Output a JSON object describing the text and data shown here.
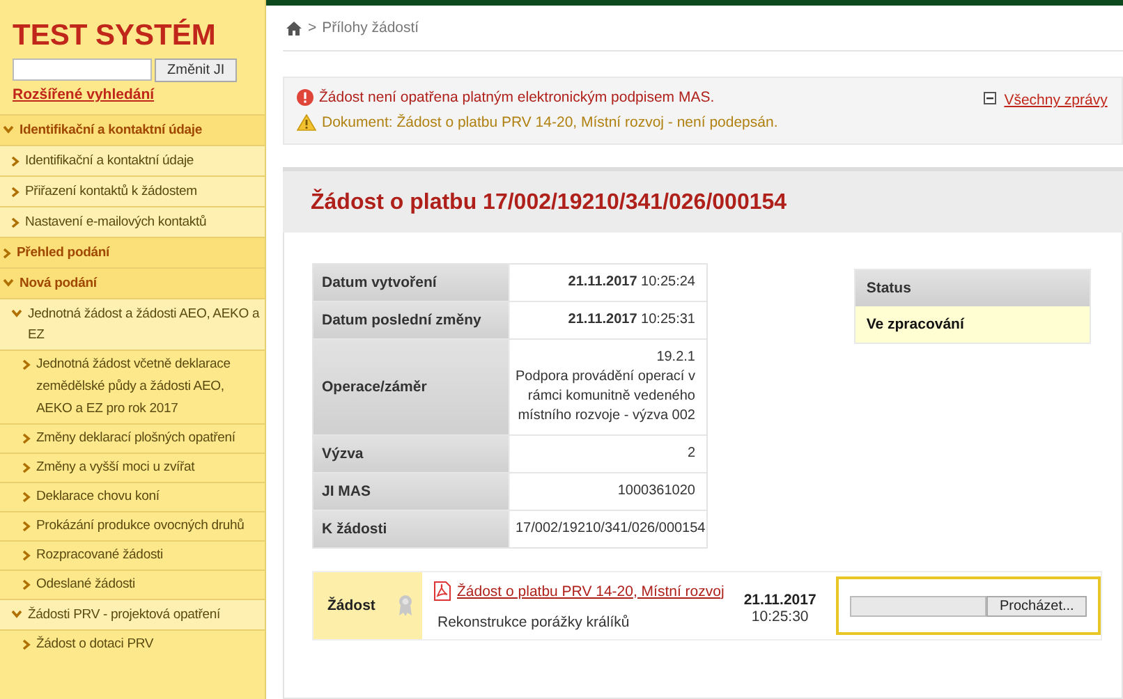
{
  "sidebar": {
    "title": "TEST SYSTÉM",
    "search_button": "Změnit JI",
    "advanced_search_link": "Rozšířené vyhledání",
    "items": [
      {
        "label": "Identifikační a kontaktní údaje",
        "expanded": true,
        "children": [
          {
            "label": "Identifikační a kontaktní údaje"
          },
          {
            "label": "Přiřazení kontaktů k žádostem"
          },
          {
            "label": "Nastavení e-mailových kontaktů"
          }
        ]
      },
      {
        "label": "Přehled podání",
        "expanded": false
      },
      {
        "label": "Nová podání",
        "expanded": true,
        "children": [
          {
            "label": "Jednotná žádost a žádosti AEO, AEKO a EZ",
            "expanded": true,
            "children": [
              {
                "label": "Jednotná žádost včetně deklarace zemědělské půdy a žádosti AEO, AEKO a EZ pro rok 2017"
              },
              {
                "label": "Změny deklarací plošných opatření"
              },
              {
                "label": "Změny a vyšší moci u zvířat"
              },
              {
                "label": "Deklarace chovu koní"
              },
              {
                "label": "Prokázání produkce ovocných druhů"
              },
              {
                "label": "Rozpracované žádosti"
              },
              {
                "label": "Odeslané žádosti"
              }
            ]
          },
          {
            "label": "Žádosti PRV - projektová opatření",
            "expanded": true,
            "children": [
              {
                "label": "Žádost o dotaci PRV"
              }
            ]
          }
        ]
      }
    ]
  },
  "breadcrumb": {
    "separator": ">",
    "page": "Přílohy žádostí"
  },
  "messages": [
    {
      "kind": "error",
      "text": "Žádost není opatřena platným elektronickým podpisem MAS."
    },
    {
      "kind": "warning",
      "text": "Dokument: Žádost o platbu PRV 14-20, Místní rozvoj - není podepsán."
    }
  ],
  "all_messages_link": "Všechny zprávy",
  "title": "Žádost o platbu 17/002/19210/341/026/000154",
  "details": [
    {
      "label": "Datum vytvoření",
      "value": "**21.11.2017** 10:25:24"
    },
    {
      "label": "Datum poslední změny",
      "value": "**21.11.2017** 10:25:31"
    },
    {
      "label": "Operace/záměr",
      "value": "19.2.1\nPodpora provádění operací v rámci komunitně vedeného místního rozvoje - výzva 002"
    },
    {
      "label": "Výzva",
      "value": "2"
    },
    {
      "label": "JI MAS",
      "value": "1000361020"
    },
    {
      "label": "K žádosti",
      "value": "17/002/19210/341/026/000154"
    }
  ],
  "status": {
    "header": "Status",
    "value": "Ve zpracování"
  },
  "attachment": {
    "label": "Žádost",
    "file_link": "Žádost o platbu PRV 14-20, Místní rozvoj",
    "description": "Rekonstrukce porážky králíků",
    "date": "21.11.2017",
    "time": "10:25:30",
    "browse_button": "Procházet...",
    "highlighted": true
  }
}
